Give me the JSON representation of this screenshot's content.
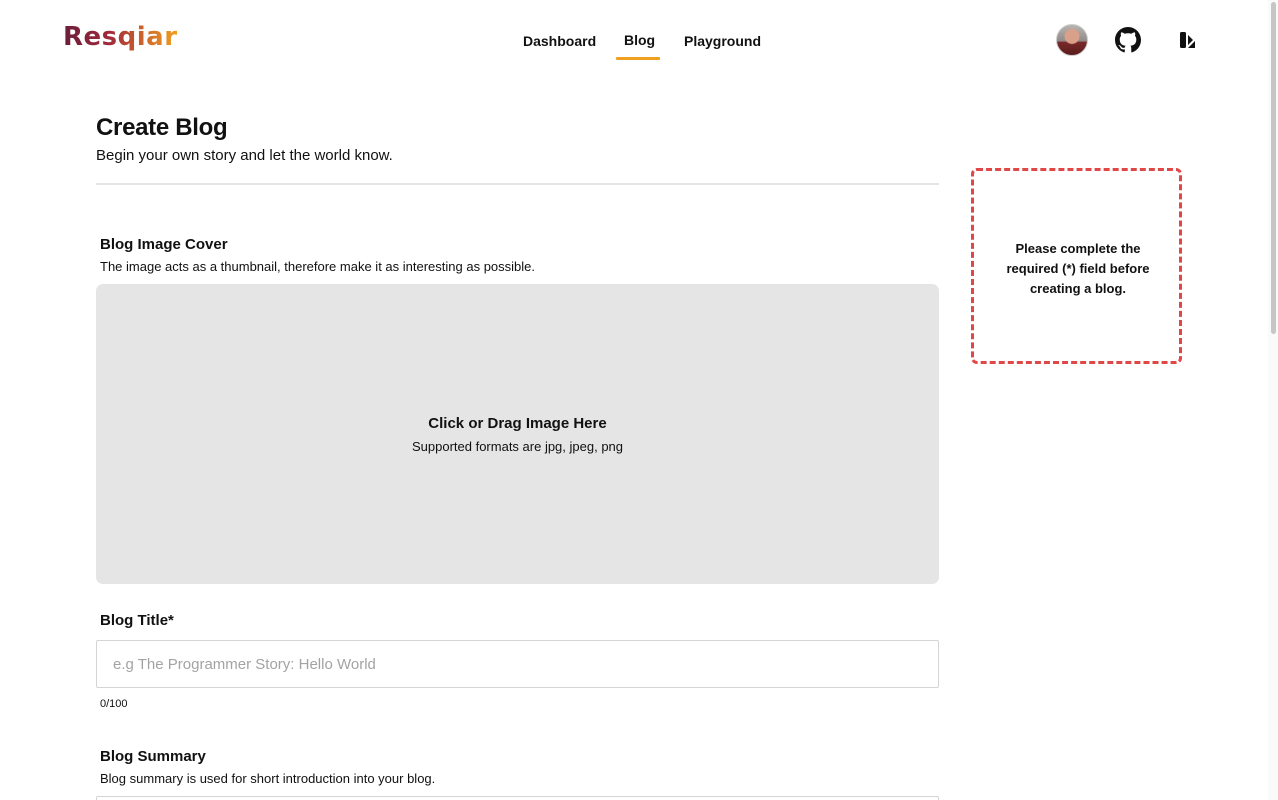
{
  "header": {
    "logo_text": "Resqiar",
    "nav": [
      {
        "label": "Dashboard",
        "active": false
      },
      {
        "label": "Blog",
        "active": true
      },
      {
        "label": "Playground",
        "active": false
      }
    ],
    "accent_color": "#f0a020",
    "icons": [
      "avatar",
      "github-icon",
      "theme-toggle-icon"
    ]
  },
  "page": {
    "title": "Create Blog",
    "subtitle": "Begin your own story and let the world know."
  },
  "cover": {
    "label": "Blog Image Cover",
    "description": "The image acts as a thumbnail, therefore make it as interesting as possible.",
    "drop_title": "Click or Drag Image Here",
    "drop_subtitle": "Supported formats are jpg, jpeg, png"
  },
  "blog_title": {
    "label": "Blog Title*",
    "placeholder": "e.g The Programmer Story: Hello World",
    "value": "",
    "counter": "0/100"
  },
  "summary": {
    "label": "Blog Summary",
    "description": "Blog summary is used for short introduction into your blog."
  },
  "warning": {
    "message": "Please complete the required (*) field before creating a blog.",
    "border_color": "#e04848"
  }
}
